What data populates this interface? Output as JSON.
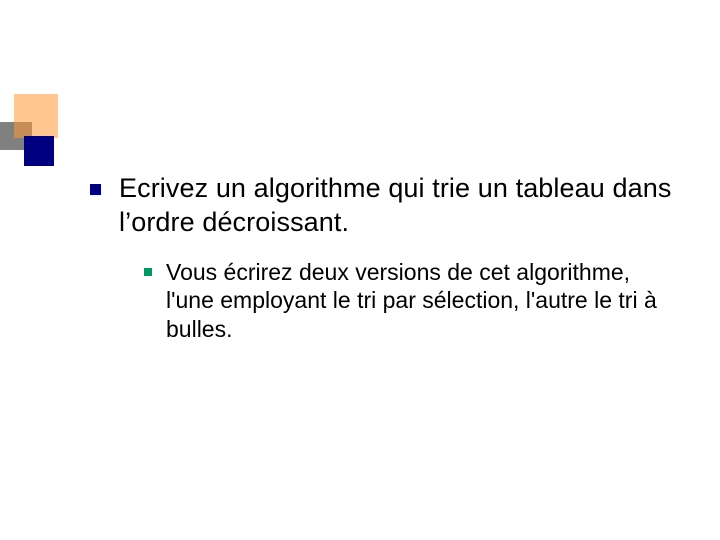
{
  "slide": {
    "bullets": [
      {
        "level": 1,
        "text": "Ecrivez un algorithme qui trie un tableau dans l’ordre décroissant."
      },
      {
        "level": 2,
        "text": "Vous écrirez deux versions de cet algorithme, l'une employant le tri par sélection, l'autre le tri à bulles."
      }
    ]
  },
  "decor": {
    "orange": "#ff9933",
    "navy": "#000080",
    "gray": "#808080",
    "green": "#009966"
  }
}
